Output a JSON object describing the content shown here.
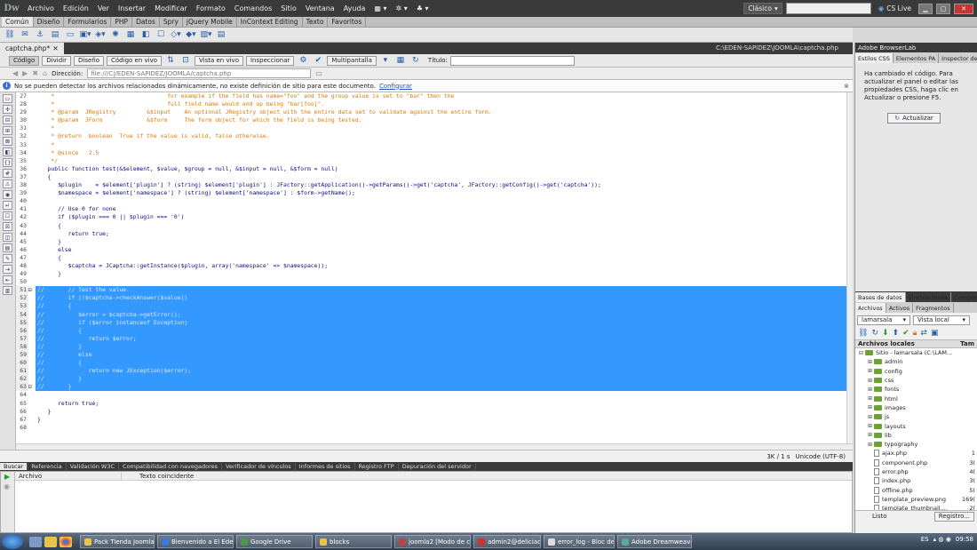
{
  "menubar": {
    "logo": "Dw",
    "items": [
      "Archivo",
      "Edición",
      "Ver",
      "Insertar",
      "Modificar",
      "Formato",
      "Comandos",
      "Sitio",
      "Ventana",
      "Ayuda"
    ],
    "workspace": "Clásico",
    "cslive": "CS Live"
  },
  "insert_tabs": [
    "Común",
    "Diseño",
    "Formularios",
    "PHP",
    "Datos",
    "Spry",
    "jQuery Mobile",
    "InContext Editing",
    "Texto",
    "Favoritos"
  ],
  "document": {
    "tab_name": "captcha.php*",
    "path": "C:\\EDEN-SAPIDEZ\\JOOMLA\\captcha.php",
    "view_buttons": [
      "Código",
      "Dividir",
      "Diseño",
      "Código en vivo",
      "Vista en vivo",
      "Inspeccionar",
      "Multipantalla"
    ],
    "title_label": "Título:",
    "address_label": "Dirección:",
    "address_value": "file:///C|/EDEN-SAPIDEZ/JOOMLA/captcha.php",
    "info_message": "No se pueden detectar los archivos relacionados dinámicamente, no existe definición de sitio para este documento.",
    "info_link": "Configurar"
  },
  "code_lines": [
    {
      "n": "27",
      "t": "    *                                 for example if the field has name=\"foo\" and the group value is set to \"bar\" then the",
      "c": 1,
      "s": 0
    },
    {
      "n": "28",
      "t": "    *                                 full field name would end up being \"bar[foo]\".",
      "c": 1,
      "s": 0
    },
    {
      "n": "29",
      "t": "    * @param  JRegistry         &$input    An optional JRegistry object with the entire data set to validate against the entire form.",
      "c": 1,
      "s": 0
    },
    {
      "n": "30",
      "t": "    * @param  JForm             &$form     The form object for which the field is being tested.",
      "c": 1,
      "s": 0
    },
    {
      "n": "31",
      "t": "    *",
      "c": 1,
      "s": 0
    },
    {
      "n": "32",
      "t": "    * @return  boolean  True if the value is valid, false otherwise.",
      "c": 1,
      "s": 0
    },
    {
      "n": "33",
      "t": "    *",
      "c": 1,
      "s": 0
    },
    {
      "n": "34",
      "t": "    * @since   2.5",
      "c": 1,
      "s": 0
    },
    {
      "n": "35",
      "t": "    */",
      "c": 1,
      "s": 0
    },
    {
      "n": "36",
      "t": "   public function test(&$element, $value, $group = null, &$input = null, &$form = null)",
      "c": 0,
      "s": 0
    },
    {
      "n": "37",
      "t": "   {",
      "c": 0,
      "s": 0
    },
    {
      "n": "38",
      "t": "      $plugin    = $element['plugin'] ? (string) $element['plugin'] : JFactory::getApplication()->getParams()->get('captcha', JFactory::getConfig()->get('captcha'));",
      "c": 0,
      "s": 0
    },
    {
      "n": "39",
      "t": "      $namespace = $element['namespace'] ? (string) $element['namespace'] : $form->getName();",
      "c": 0,
      "s": 0
    },
    {
      "n": "40",
      "t": "",
      "c": 0,
      "s": 0
    },
    {
      "n": "41",
      "t": "      // Use 0 for none",
      "c": 0,
      "s": 0
    },
    {
      "n": "42",
      "t": "      if ($plugin === 0 || $plugin === '0')",
      "c": 0,
      "s": 0
    },
    {
      "n": "43",
      "t": "      {",
      "c": 0,
      "s": 0
    },
    {
      "n": "44",
      "t": "         return true;",
      "c": 0,
      "s": 0
    },
    {
      "n": "45",
      "t": "      }",
      "c": 0,
      "s": 0
    },
    {
      "n": "46",
      "t": "      else",
      "c": 0,
      "s": 0
    },
    {
      "n": "47",
      "t": "      {",
      "c": 0,
      "s": 0
    },
    {
      "n": "48",
      "t": "         $captcha = JCaptcha::getInstance($plugin, array('namespace' => $namespace));",
      "c": 0,
      "s": 0
    },
    {
      "n": "49",
      "t": "      }",
      "c": 0,
      "s": 0
    },
    {
      "n": "50",
      "t": "",
      "c": 0,
      "s": 0
    },
    {
      "n": "51",
      "t": "//       // Test the value.",
      "c": 0,
      "s": 1
    },
    {
      "n": "52",
      "t": "//       if (!$captcha->checkAnswer($value))",
      "c": 0,
      "s": 1
    },
    {
      "n": "53",
      "t": "//       {",
      "c": 0,
      "s": 1
    },
    {
      "n": "54",
      "t": "//          $error = $captcha->getError();",
      "c": 0,
      "s": 1
    },
    {
      "n": "55",
      "t": "//          if ($error instanceof Exception)",
      "c": 0,
      "s": 1
    },
    {
      "n": "56",
      "t": "//          {",
      "c": 0,
      "s": 1
    },
    {
      "n": "57",
      "t": "//             return $error;",
      "c": 0,
      "s": 1
    },
    {
      "n": "58",
      "t": "//          }",
      "c": 0,
      "s": 1
    },
    {
      "n": "59",
      "t": "//          else",
      "c": 0,
      "s": 1
    },
    {
      "n": "60",
      "t": "//          {",
      "c": 0,
      "s": 1
    },
    {
      "n": "61",
      "t": "//             return new JException($error);",
      "c": 0,
      "s": 1
    },
    {
      "n": "62",
      "t": "//          }",
      "c": 0,
      "s": 1
    },
    {
      "n": "63",
      "t": "//       }",
      "c": 0,
      "s": 1
    },
    {
      "n": "64",
      "t": "",
      "c": 0,
      "s": 0
    },
    {
      "n": "65",
      "t": "      return true;",
      "c": 0,
      "s": 0
    },
    {
      "n": "66",
      "t": "   }",
      "c": 0,
      "s": 0
    },
    {
      "n": "67",
      "t": "}",
      "c": 0,
      "s": 0
    },
    {
      "n": "68",
      "t": "",
      "c": 0,
      "s": 0
    }
  ],
  "status": {
    "size": "3K / 1 s",
    "encoding": "Unicode (UTF-8)"
  },
  "results_tabs": [
    "Buscar",
    "Referencia",
    "Validación W3C",
    "Compatibilidad con navegadores",
    "Verificador de vínculos",
    "Informes de sitios",
    "Registro FTP",
    "Depuración del servidor"
  ],
  "results_headers": {
    "file": "Archivo",
    "match": "Texto coincidente"
  },
  "right_panels": {
    "browserlab": "Adobe BrowserLab",
    "css_tabs": [
      "Estilos CSS",
      "Elementos PA",
      "Inspector de"
    ],
    "css_message": "Ha cambiado el código. Para actualizar el panel o editar las propiedades CSS, haga clic en Actualizar o presione F5.",
    "update_button": "Actualizar",
    "db_tabs": [
      "Bases de datos",
      "Vinculaciones",
      "Comportam"
    ],
    "files_tabs": [
      "Archivos",
      "Activos",
      "Fragmentos"
    ],
    "site_select": "lamarsala",
    "view_select": "Vista local",
    "local_files_header": "Archivos locales",
    "size_header": "Tam",
    "tree": [
      {
        "name": "Sitio - lamarsala (C:\\LAM...",
        "type": "site",
        "size": ""
      },
      {
        "name": "admin",
        "type": "folder",
        "size": ""
      },
      {
        "name": "config",
        "type": "folder",
        "size": ""
      },
      {
        "name": "css",
        "type": "folder",
        "size": ""
      },
      {
        "name": "fonts",
        "type": "folder",
        "size": ""
      },
      {
        "name": "html",
        "type": "folder",
        "size": ""
      },
      {
        "name": "images",
        "type": "folder",
        "size": ""
      },
      {
        "name": "js",
        "type": "folder",
        "size": ""
      },
      {
        "name": "layouts",
        "type": "folder",
        "size": ""
      },
      {
        "name": "lib",
        "type": "folder",
        "size": ""
      },
      {
        "name": "typography",
        "type": "folder",
        "size": ""
      },
      {
        "name": "ajax.php",
        "type": "file",
        "size": "1"
      },
      {
        "name": "component.php",
        "type": "file",
        "size": "3("
      },
      {
        "name": "error.php",
        "type": "file",
        "size": "4("
      },
      {
        "name": "index.php",
        "type": "file",
        "size": "3("
      },
      {
        "name": "offline.php",
        "type": "file",
        "size": "5("
      },
      {
        "name": "template_preview.png",
        "type": "file",
        "size": "169("
      },
      {
        "name": "template_thumbnail....",
        "type": "file",
        "size": "2("
      }
    ],
    "status_label": "Listo",
    "registry_button": "Registro..."
  },
  "taskbar": {
    "tasks": [
      "Pack Tienda Joomla...",
      "Bienvenido a El Ede...",
      "Google Drive",
      "blocks",
      "joomla2 [Modo de c...",
      "admin2@deliciadeg...",
      "error_log - Bloc de n...",
      "Adobe Dreamweave..."
    ],
    "lang": "ES",
    "clock": "09:58"
  },
  "colors": {
    "selection": "#3399ff",
    "comment": "#e07b00",
    "code": "#0b0b8a"
  }
}
